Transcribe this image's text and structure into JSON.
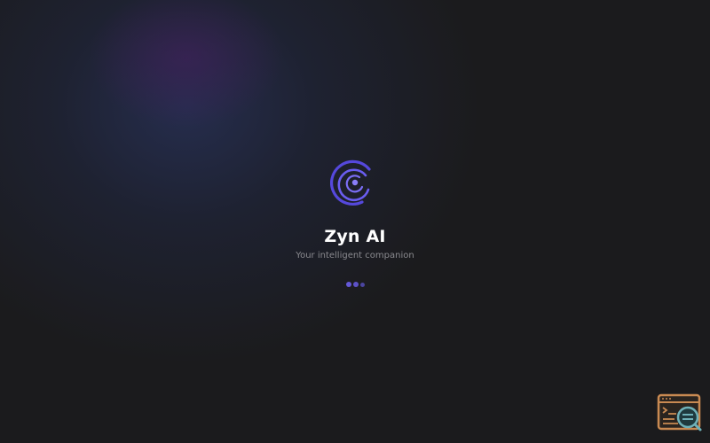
{
  "app": {
    "name": "Zyn AI",
    "tagline": "Your intelligent companion"
  },
  "loading": {
    "dot_count": 3
  },
  "icons": {
    "logo": "spiral-logo-icon",
    "devtools": "devtools-inspector-icon"
  },
  "colors": {
    "background": "#1b1b1d",
    "accent": "#6458d8",
    "logo_outer": "#5b4de0",
    "logo_inner": "#7a6cf0",
    "devtools_frame": "#c98a52",
    "devtools_lens": "#6fb1b8"
  }
}
